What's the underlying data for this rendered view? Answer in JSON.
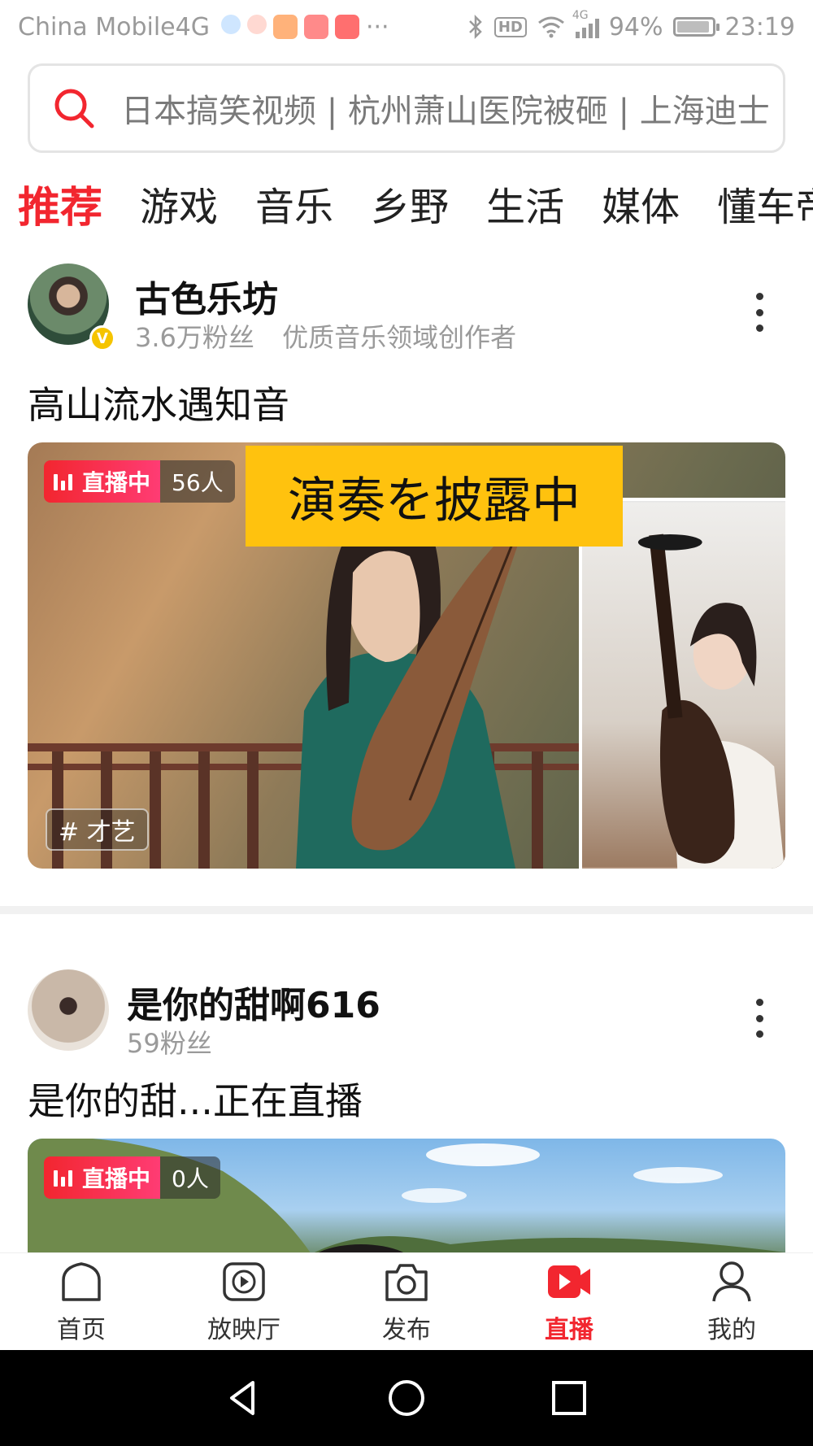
{
  "status_bar": {
    "carrier": "China Mobile4G",
    "signal_label": "4G",
    "hd": "HD",
    "battery": "94%",
    "battery_level": 0.94,
    "time": "23:19",
    "more": "···"
  },
  "search": {
    "placeholder": "日本搞笑视频 | 杭州萧山医院被砸 | 上海迪士"
  },
  "tabs": [
    {
      "label": "推荐",
      "active": true
    },
    {
      "label": "游戏"
    },
    {
      "label": "音乐"
    },
    {
      "label": "乡野"
    },
    {
      "label": "生活"
    },
    {
      "label": "媒体"
    },
    {
      "label": "懂车帝"
    }
  ],
  "feed": [
    {
      "author": "古色乐坊",
      "verified_mark": "V",
      "followers": "3.6万粉丝",
      "description": "优质音乐领域创作者",
      "title": "高山流水遇知音",
      "live_label": "直播中",
      "viewers": "56人",
      "overlay_caption": "演奏を披露中",
      "topic": "# 才艺"
    },
    {
      "author": "是你的甜啊616",
      "followers": "59粉丝",
      "title": "是你的甜...正在直播",
      "live_label": "直播中",
      "viewers": "0人"
    }
  ],
  "bottom_nav": [
    {
      "label": "首页",
      "icon": "home-icon"
    },
    {
      "label": "放映厅",
      "icon": "play-icon"
    },
    {
      "label": "发布",
      "icon": "camera-icon"
    },
    {
      "label": "直播",
      "icon": "live-video-icon",
      "active": true
    },
    {
      "label": "我的",
      "icon": "profile-icon"
    }
  ],
  "colors": {
    "accent": "#f2262f",
    "live_gradient_end": "#ff3c74",
    "caption_bg": "#ffc20e",
    "verified": "#f5c400"
  }
}
